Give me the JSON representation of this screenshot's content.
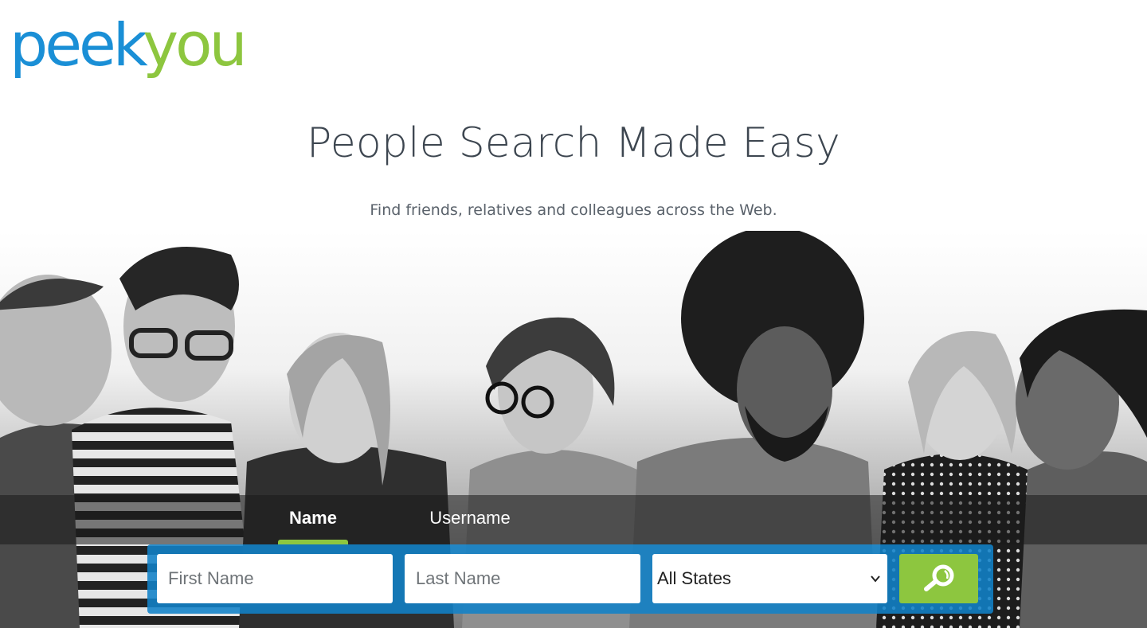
{
  "brand": {
    "logo_part1": "peek",
    "logo_part2": "you",
    "color_primary": "#1a8fd6",
    "color_accent": "#8dc63f"
  },
  "hero": {
    "title": "People Search Made Easy",
    "subtitle": "Find friends, relatives and colleagues across the Web."
  },
  "tabs": [
    {
      "label": "Name",
      "active": true
    },
    {
      "label": "Username",
      "active": false
    }
  ],
  "search": {
    "first_name_placeholder": "First Name",
    "last_name_placeholder": "Last Name",
    "state_selected": "All States",
    "button_icon": "search-icon"
  }
}
